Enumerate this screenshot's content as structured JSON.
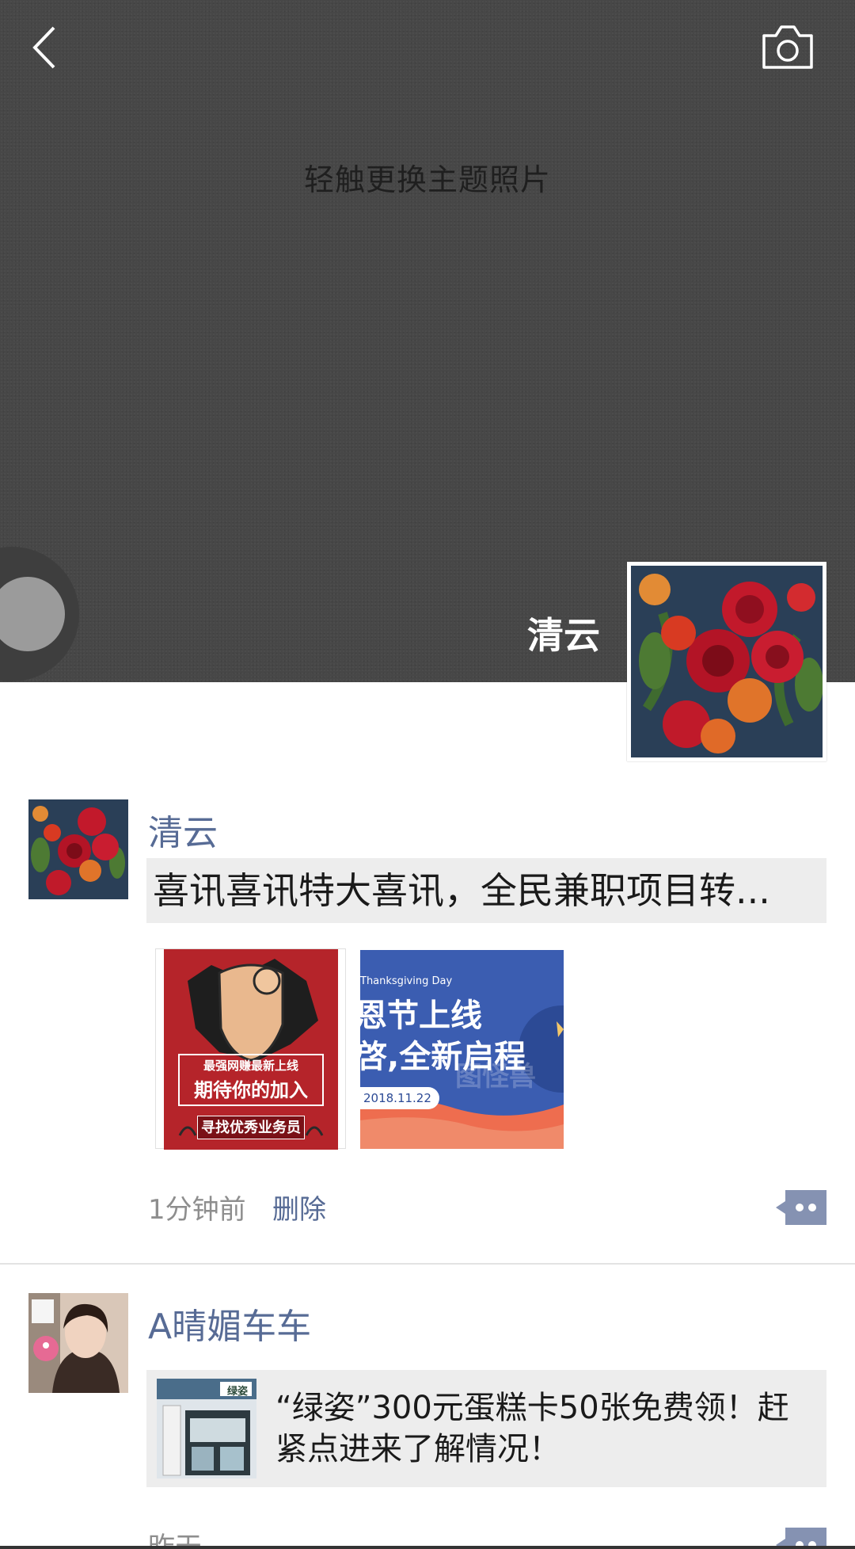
{
  "header": {
    "back_icon": "chevron-left-icon",
    "camera_icon": "camera-icon",
    "cover_hint": "轻触更换主题照片",
    "profile_name": "清云"
  },
  "posts": [
    {
      "nickname": "清云",
      "text": "喜讯喜讯特大喜讯，全民兼职项目转...",
      "images": [
        {
          "line1": "最强网赚最新上线",
          "line2": "期待你的加入",
          "line3": "寻找优秀业务员"
        },
        {
          "line0": "Thanksgiving Day",
          "line1": "恩节上线",
          "line2": "啓,全新启程",
          "date": "2018.11.22",
          "watermark": "图怪兽"
        }
      ],
      "time": "1分钟前",
      "delete_label": "删除"
    },
    {
      "nickname": "A晴媚车车",
      "link_title": "“绿姿”300元蛋糕卡50张免费领！赶紧点进来了解情况！",
      "link_thumb_brand": "绿姿",
      "time": "昨天"
    }
  ],
  "colors": {
    "nickname": "#576b95",
    "cover": "#474747",
    "comment_button": "#8592b2"
  }
}
